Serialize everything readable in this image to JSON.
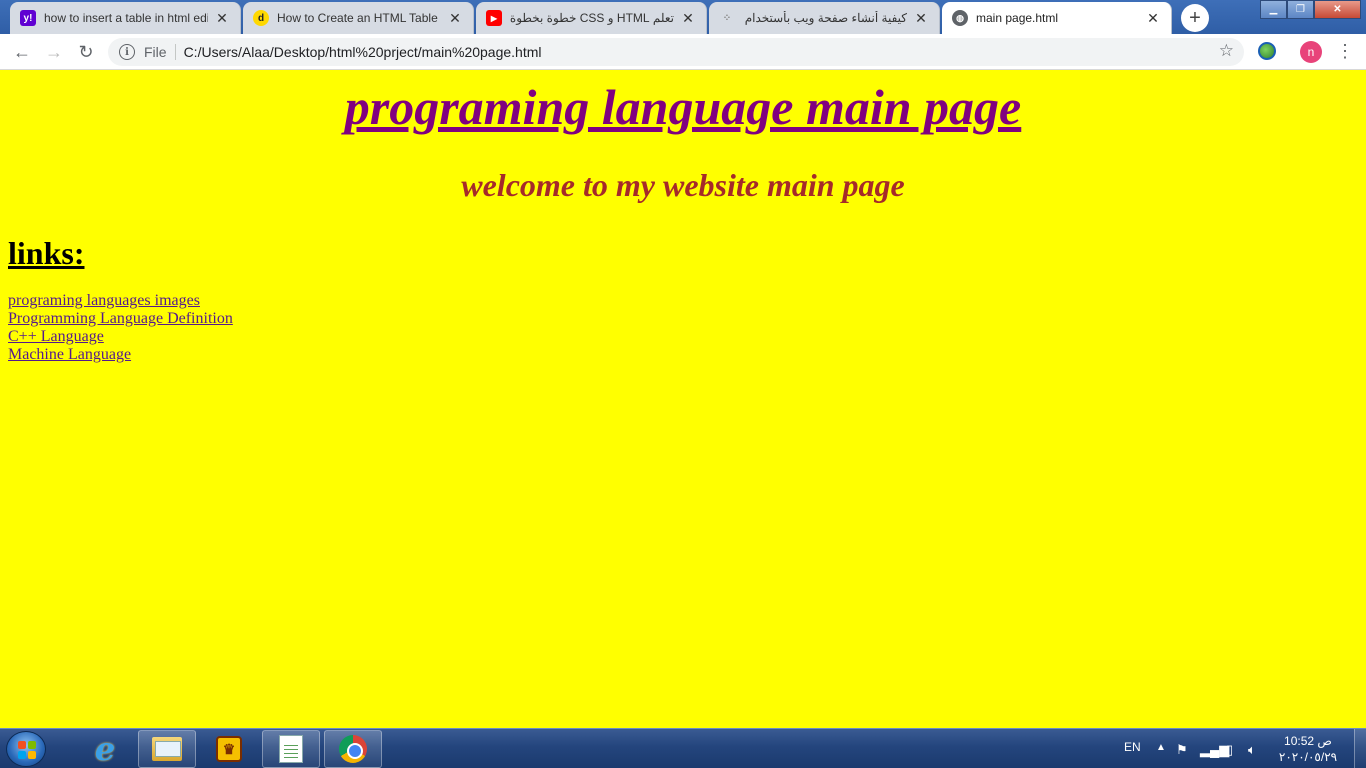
{
  "browser": {
    "tabs": [
      {
        "title": "how to insert a table in html edi",
        "favicon": "yahoo-icon",
        "favicon_color": "#6001d2"
      },
      {
        "title": "How to Create an HTML Table",
        "favicon": "dotdash-icon",
        "favicon_color": "#ffd800"
      },
      {
        "title": "تعلم HTML و CSS خطوة بخطوة بطريقة",
        "favicon": "youtube-icon",
        "favicon_color": "#ff0000"
      },
      {
        "title": "كيفية أنشاء صفحة ويب بأستخدام لغة TML",
        "favicon": "spinner-icon",
        "favicon_color": "#888888"
      },
      {
        "title": "main page.html",
        "favicon": "globe-icon",
        "favicon_color": "#5f6368"
      }
    ],
    "new_tab_label": "+",
    "address": {
      "scheme_label": "File",
      "url": "C:/Users/Alaa/Desktop/html%20prject/main%20page.html"
    },
    "profile_initial": "n"
  },
  "page": {
    "title": "programing language main page",
    "welcome": "welcome to my website main page",
    "links_heading": "links:",
    "links": [
      "programing languages images",
      "Programming Language Definition",
      "C++ Language",
      "Machine Language"
    ],
    "colors": {
      "background": "#ffff00",
      "title": "#800080",
      "welcome": "#a52a2a",
      "link": "#551a8b"
    }
  },
  "taskbar": {
    "language": "EN",
    "clock": {
      "time": "10:52 ص",
      "date": "٢٠٢٠/٠٥/٢٩"
    }
  }
}
